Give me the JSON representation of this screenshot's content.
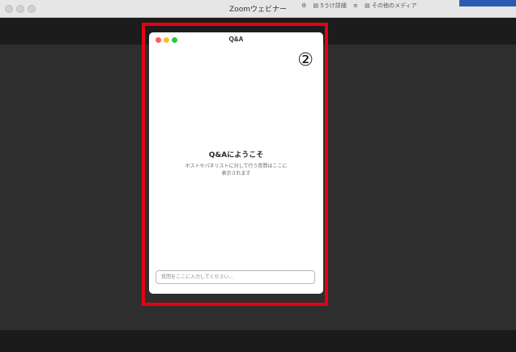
{
  "window": {
    "title": "Zoomウェビナー"
  },
  "menubar": {
    "item1": "⚙",
    "item2": "▤ 5うけ詳細",
    "item3": "≡",
    "item4": "▤ その他のメディア"
  },
  "qa_panel": {
    "title": "Q&A",
    "step_marker": "②",
    "welcome_title": "Q&Aにようこそ",
    "welcome_description": "ホストやパネリストに対して行う質問はここに表示されます",
    "input_placeholder": "質問をここに入力してください..."
  },
  "colors": {
    "highlight": "#e60012",
    "close": "#ff5f57",
    "minimize": "#febc2e",
    "zoom": "#28c840"
  },
  "icons": [
    "close-icon",
    "minimize-icon",
    "zoom-icon"
  ]
}
